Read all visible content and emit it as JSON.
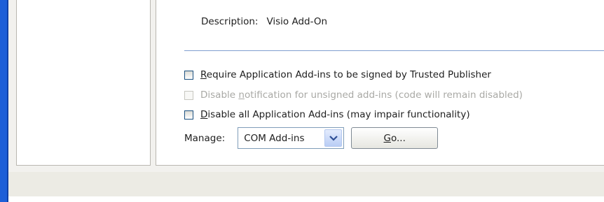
{
  "addin": {
    "description_label": "Description:",
    "description_value": "Visio Add-On"
  },
  "options": [
    {
      "pre": "",
      "accel": "R",
      "post": "equire Application Add-ins to be signed by Trusted Publisher",
      "checked": false,
      "enabled": true
    },
    {
      "pre": "Disable ",
      "accel": "n",
      "post": "otification for unsigned add-ins (code will remain disabled)",
      "checked": false,
      "enabled": false
    },
    {
      "pre": "",
      "accel": "D",
      "post": "isable all Application Add-ins (may impair functionality)",
      "checked": false,
      "enabled": true
    }
  ],
  "manage": {
    "label": "Manage:",
    "selected": "COM Add-ins",
    "go_accel": "G",
    "go_rest": "o..."
  },
  "icons": {
    "dropdown": "chevron-down-icon"
  }
}
